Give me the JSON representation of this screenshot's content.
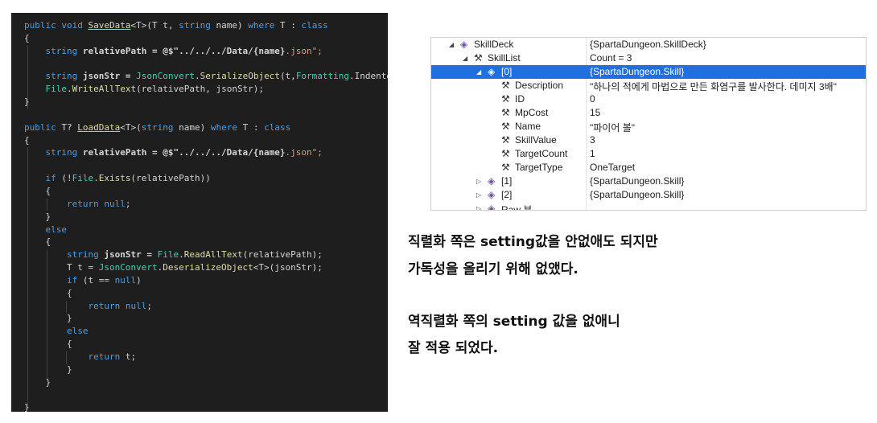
{
  "code_lines": [
    [
      {
        "t": "public void ",
        "c": "kw"
      },
      {
        "t": "SaveData",
        "c": "mt ul"
      },
      {
        "t": "<T>",
        "c": ""
      },
      {
        "t": "(T t, ",
        "c": ""
      },
      {
        "t": "string",
        "c": "kw"
      },
      {
        "t": " name) ",
        "c": ""
      },
      {
        "t": "where",
        "c": "kw"
      },
      {
        "t": " T : ",
        "c": ""
      },
      {
        "t": "class",
        "c": "kw"
      }
    ],
    [
      {
        "t": "{",
        "c": ""
      }
    ],
    [
      {
        "t": "    ",
        "c": ""
      },
      {
        "t": "string",
        "c": "kw"
      },
      {
        "t": " relativePath = @$\"../../../Data/",
        "c": "bold"
      },
      {
        "t": "{name}",
        "c": "bold"
      },
      {
        "t": ".json\";",
        "c": "str"
      }
    ],
    [
      {
        "t": "",
        "c": ""
      }
    ],
    [
      {
        "t": "    ",
        "c": ""
      },
      {
        "t": "string",
        "c": "kw"
      },
      {
        "t": " jsonStr = ",
        "c": "bold"
      },
      {
        "t": "JsonConvert",
        "c": "ty"
      },
      {
        "t": ".",
        "c": ""
      },
      {
        "t": "SerializeObject",
        "c": "mt"
      },
      {
        "t": "(t,",
        "c": ""
      },
      {
        "t": "Formatting",
        "c": "ty"
      },
      {
        "t": ".Indented);",
        "c": ""
      }
    ],
    [
      {
        "t": "    ",
        "c": ""
      },
      {
        "t": "File",
        "c": "ty"
      },
      {
        "t": ".",
        "c": ""
      },
      {
        "t": "WriteAllText",
        "c": "mt"
      },
      {
        "t": "(relativePath, jsonStr);",
        "c": ""
      }
    ],
    [
      {
        "t": "}",
        "c": ""
      }
    ],
    [
      {
        "t": "",
        "c": ""
      }
    ],
    [
      {
        "t": "public ",
        "c": "kw"
      },
      {
        "t": "T? ",
        "c": ""
      },
      {
        "t": "LoadData",
        "c": "mt ul"
      },
      {
        "t": "<T>(",
        "c": ""
      },
      {
        "t": "string",
        "c": "kw"
      },
      {
        "t": " name) ",
        "c": ""
      },
      {
        "t": "where",
        "c": "kw"
      },
      {
        "t": " T : ",
        "c": ""
      },
      {
        "t": "class",
        "c": "kw"
      }
    ],
    [
      {
        "t": "{",
        "c": ""
      }
    ],
    [
      {
        "t": "    ",
        "c": ""
      },
      {
        "t": "string",
        "c": "kw"
      },
      {
        "t": " relativePath = @$\"../../../Data/",
        "c": "bold"
      },
      {
        "t": "{name}",
        "c": "bold"
      },
      {
        "t": ".json\";",
        "c": "str"
      }
    ],
    [
      {
        "t": "",
        "c": ""
      }
    ],
    [
      {
        "t": "    ",
        "c": ""
      },
      {
        "t": "if",
        "c": "kw"
      },
      {
        "t": " (!",
        "c": ""
      },
      {
        "t": "File",
        "c": "ty"
      },
      {
        "t": ".",
        "c": ""
      },
      {
        "t": "Exists",
        "c": "mt"
      },
      {
        "t": "(relativePath))",
        "c": ""
      }
    ],
    [
      {
        "t": "    {",
        "c": ""
      }
    ],
    [
      {
        "t": "        ",
        "c": ""
      },
      {
        "t": "return",
        "c": "kw"
      },
      {
        "t": " ",
        "c": ""
      },
      {
        "t": "null",
        "c": "kw"
      },
      {
        "t": ";",
        "c": ""
      }
    ],
    [
      {
        "t": "    }",
        "c": ""
      }
    ],
    [
      {
        "t": "    ",
        "c": ""
      },
      {
        "t": "else",
        "c": "kw"
      }
    ],
    [
      {
        "t": "    {",
        "c": ""
      }
    ],
    [
      {
        "t": "        ",
        "c": ""
      },
      {
        "t": "string",
        "c": "kw"
      },
      {
        "t": " jsonStr = ",
        "c": "bold"
      },
      {
        "t": "File",
        "c": "ty"
      },
      {
        "t": ".",
        "c": ""
      },
      {
        "t": "ReadAllText",
        "c": "mt"
      },
      {
        "t": "(relativePath);",
        "c": ""
      }
    ],
    [
      {
        "t": "        T t = ",
        "c": ""
      },
      {
        "t": "JsonConvert",
        "c": "ty"
      },
      {
        "t": ".",
        "c": ""
      },
      {
        "t": "DeserializeObject",
        "c": "mt"
      },
      {
        "t": "<T>(jsonStr);",
        "c": ""
      }
    ],
    [
      {
        "t": "        ",
        "c": ""
      },
      {
        "t": "if",
        "c": "kw"
      },
      {
        "t": " (t == ",
        "c": ""
      },
      {
        "t": "null",
        "c": "kw"
      },
      {
        "t": ")",
        "c": ""
      }
    ],
    [
      {
        "t": "        {",
        "c": ""
      }
    ],
    [
      {
        "t": "            ",
        "c": ""
      },
      {
        "t": "return",
        "c": "kw"
      },
      {
        "t": " ",
        "c": ""
      },
      {
        "t": "null",
        "c": "kw"
      },
      {
        "t": ";",
        "c": ""
      }
    ],
    [
      {
        "t": "        }",
        "c": ""
      }
    ],
    [
      {
        "t": "        ",
        "c": ""
      },
      {
        "t": "else",
        "c": "kw"
      }
    ],
    [
      {
        "t": "        {",
        "c": ""
      }
    ],
    [
      {
        "t": "            ",
        "c": ""
      },
      {
        "t": "return",
        "c": "kw"
      },
      {
        "t": " t;",
        "c": ""
      }
    ],
    [
      {
        "t": "        }",
        "c": ""
      }
    ],
    [
      {
        "t": "    }",
        "c": ""
      }
    ],
    [
      {
        "t": "",
        "c": ""
      }
    ],
    [
      {
        "t": "}",
        "c": ""
      }
    ]
  ],
  "watch_rows": [
    {
      "depth": 0,
      "arrow": "◢",
      "icon": "box",
      "name": "SkillDeck",
      "value": "{SpartaDungeon.SkillDeck}",
      "selected": false
    },
    {
      "depth": 1,
      "arrow": "◢",
      "icon": "wrench",
      "name": "SkillList",
      "value": "Count = 3",
      "selected": false
    },
    {
      "depth": 2,
      "arrow": "◢",
      "icon": "box",
      "name": "[0]",
      "value": "{SpartaDungeon.Skill}",
      "selected": true
    },
    {
      "depth": 3,
      "arrow": "",
      "icon": "wrench",
      "name": "Description",
      "value": "\"하나의 적에게 마법으로 만든 화염구를 발사한다. 데미지 3배\"",
      "selected": false
    },
    {
      "depth": 3,
      "arrow": "",
      "icon": "wrench",
      "name": "ID",
      "value": "0",
      "selected": false
    },
    {
      "depth": 3,
      "arrow": "",
      "icon": "wrench",
      "name": "MpCost",
      "value": "15",
      "selected": false
    },
    {
      "depth": 3,
      "arrow": "",
      "icon": "wrench",
      "name": "Name",
      "value": "\"파이어 볼\"",
      "selected": false
    },
    {
      "depth": 3,
      "arrow": "",
      "icon": "wrench",
      "name": "SkillValue",
      "value": "3",
      "selected": false
    },
    {
      "depth": 3,
      "arrow": "",
      "icon": "wrench",
      "name": "TargetCount",
      "value": "1",
      "selected": false
    },
    {
      "depth": 3,
      "arrow": "",
      "icon": "wrench",
      "name": "TargetType",
      "value": "OneTarget",
      "selected": false
    },
    {
      "depth": 2,
      "arrow": "▷",
      "icon": "box",
      "name": "[1]",
      "value": "{SpartaDungeon.Skill}",
      "selected": false
    },
    {
      "depth": 2,
      "arrow": "▷",
      "icon": "box",
      "name": "[2]",
      "value": "{SpartaDungeon.Skill}",
      "selected": false
    },
    {
      "depth": 2,
      "arrow": "▷",
      "icon": "box",
      "name": "Raw 뷰",
      "value": "",
      "selected": false
    }
  ],
  "notes": {
    "line1": "직렬화 쪽은 setting값을 안없애도 되지만",
    "line2": "가독성을 올리기 위해 없앴다.",
    "line3": "역직렬화 쪽의 setting 값을 없애니",
    "line4": "잘 적용 되었다."
  }
}
